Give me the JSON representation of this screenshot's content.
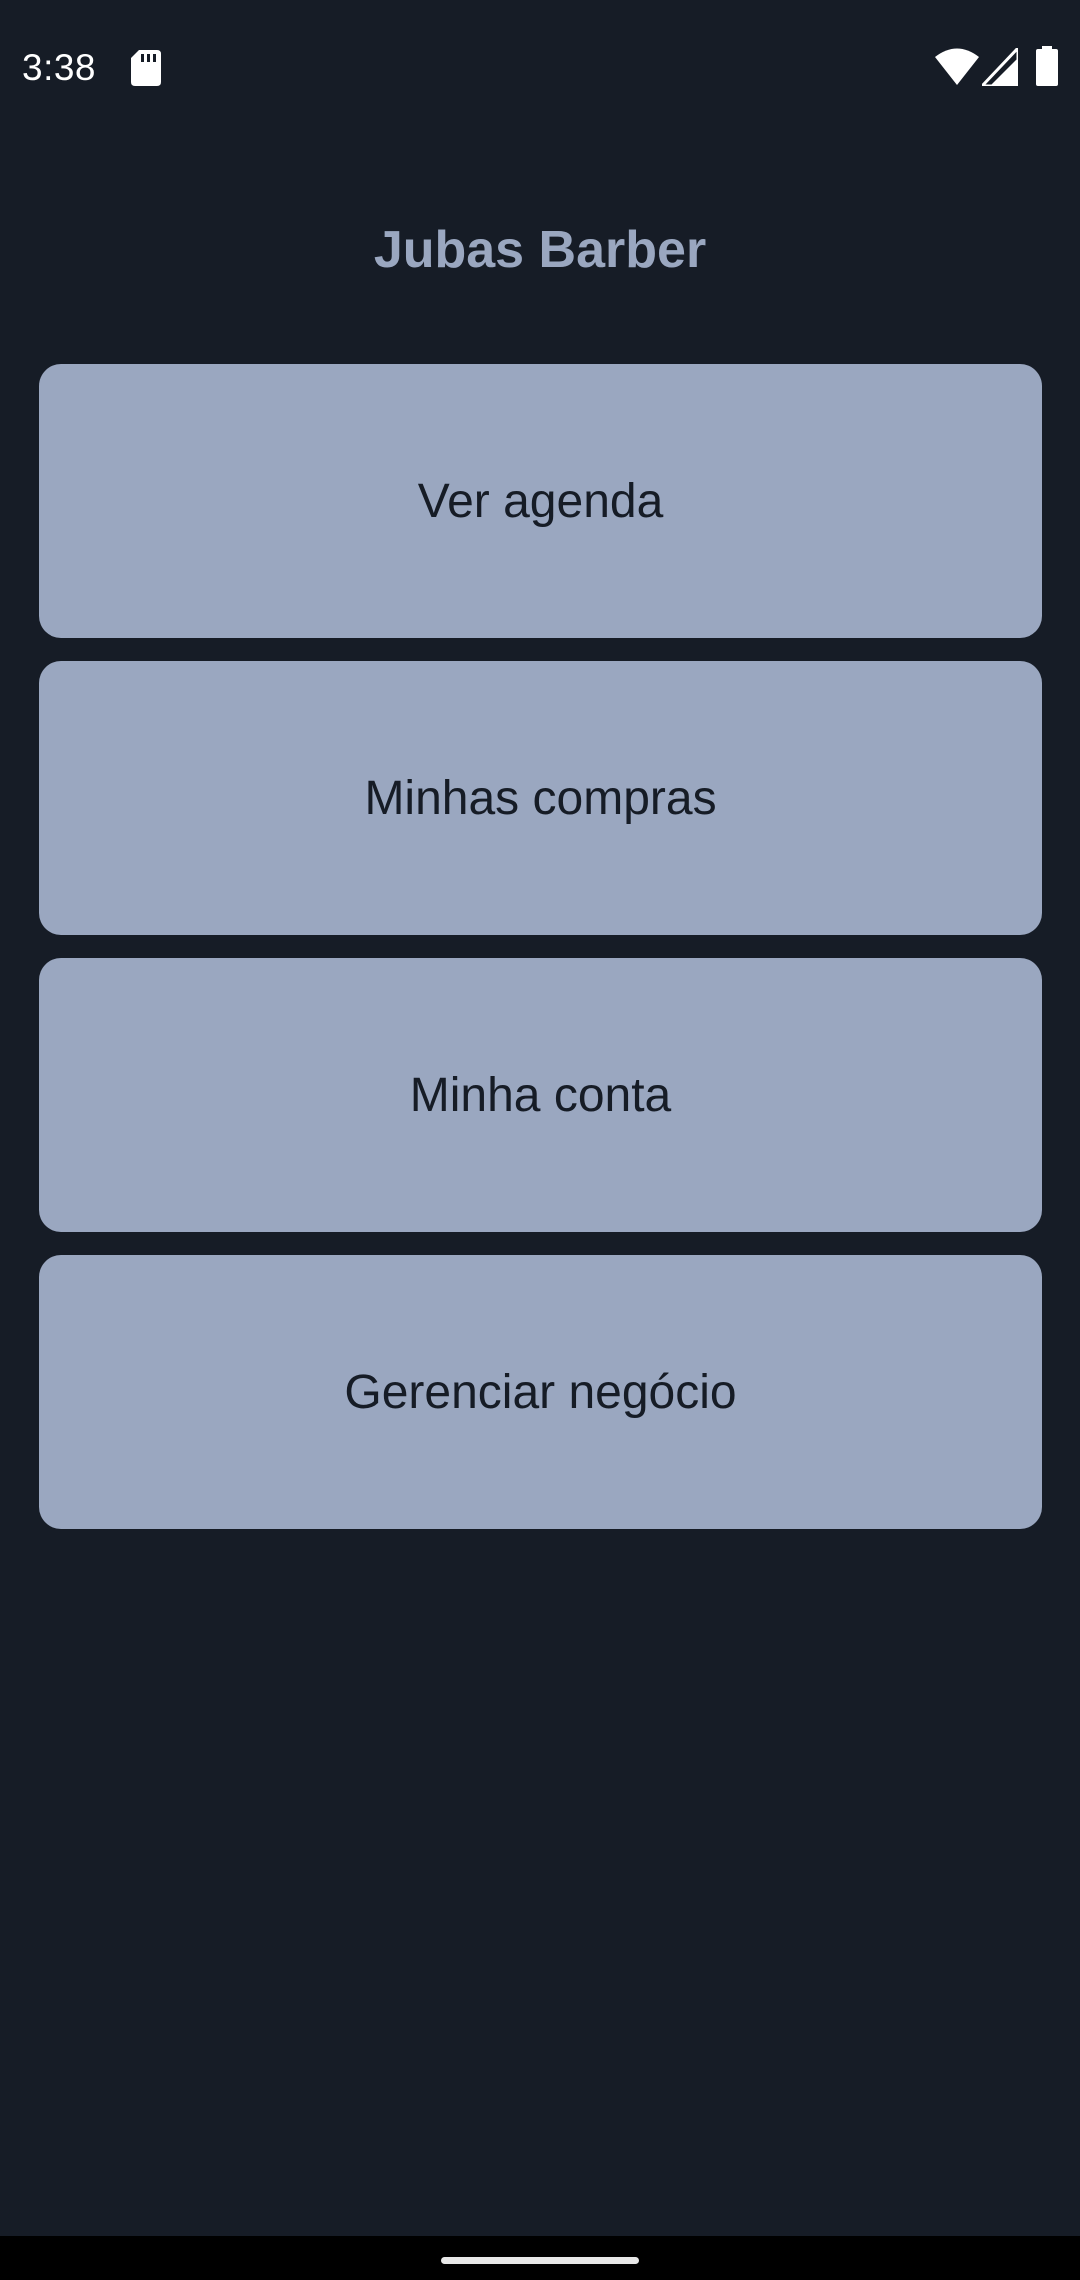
{
  "status_bar": {
    "time": "3:38",
    "icons": [
      "sd-card-icon",
      "wifi-icon",
      "cell-signal-icon",
      "battery-icon"
    ]
  },
  "app": {
    "title": "Jubas Barber"
  },
  "menu": {
    "items": [
      {
        "label": "Ver agenda"
      },
      {
        "label": "Minhas compras"
      },
      {
        "label": "Minha conta"
      },
      {
        "label": "Gerenciar negócio"
      }
    ]
  },
  "colors": {
    "background": "#161c26",
    "button_bg": "#9aa7c0",
    "button_text": "#161c26",
    "title_text": "#9aa7c0"
  }
}
